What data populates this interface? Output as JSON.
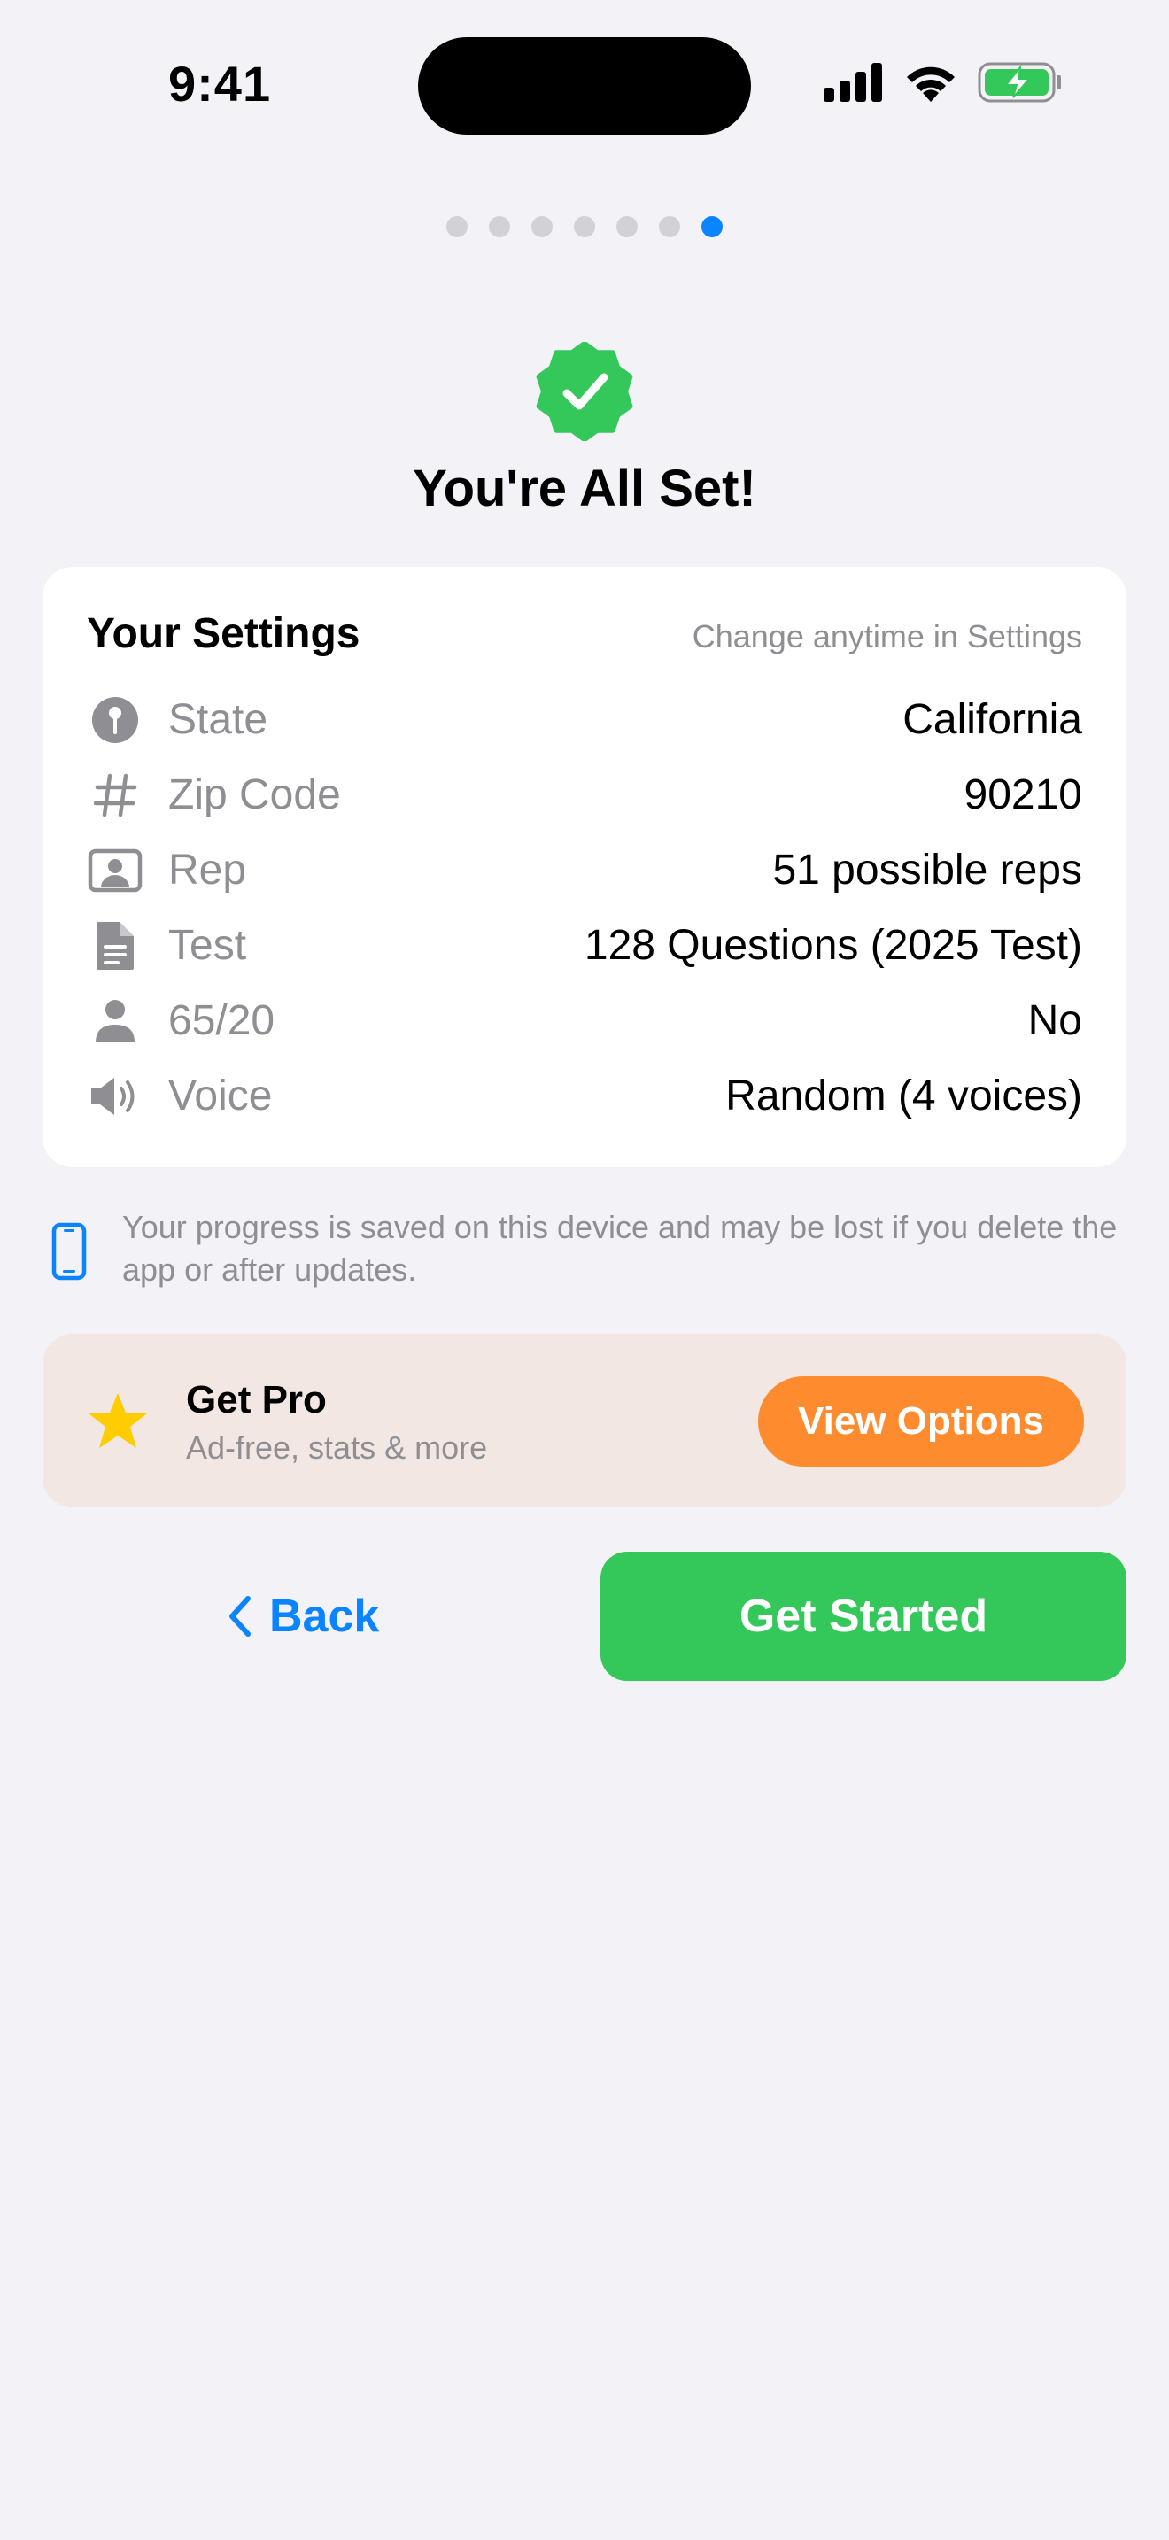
{
  "status_bar": {
    "time": "9:41"
  },
  "pager": {
    "total_pages": 7,
    "current_page": 7
  },
  "header": {
    "title": "You're All Set!",
    "icon": "checkmark-seal-icon",
    "accent_color": "#34c759"
  },
  "settings_card": {
    "title": "Your Settings",
    "hint": "Change anytime in Settings",
    "rows": [
      {
        "icon": "map-pin-icon",
        "label": "State",
        "value": "California"
      },
      {
        "icon": "number-sign-icon",
        "label": "Zip Code",
        "value": "90210"
      },
      {
        "icon": "person-card-icon",
        "label": "Rep",
        "value": "51 possible reps"
      },
      {
        "icon": "document-icon",
        "label": "Test",
        "value": "128 Questions (2025 Test)"
      },
      {
        "icon": "person-icon",
        "label": "65/20",
        "value": "No"
      },
      {
        "icon": "speaker-icon",
        "label": "Voice",
        "value": "Random (4 voices)"
      }
    ]
  },
  "notice": {
    "icon": "iphone-icon",
    "text": "Your progress is saved on this device and may be lost if you delete the app or after updates."
  },
  "pro": {
    "icon": "star-icon",
    "title": "Get Pro",
    "subtitle": "Ad-free, stats & more",
    "button_label": "View Options",
    "button_color": "#fe8c2e"
  },
  "footer": {
    "back_label": "Back",
    "start_label": "Get Started",
    "start_color": "#34c759",
    "link_color": "#0a84ff"
  }
}
